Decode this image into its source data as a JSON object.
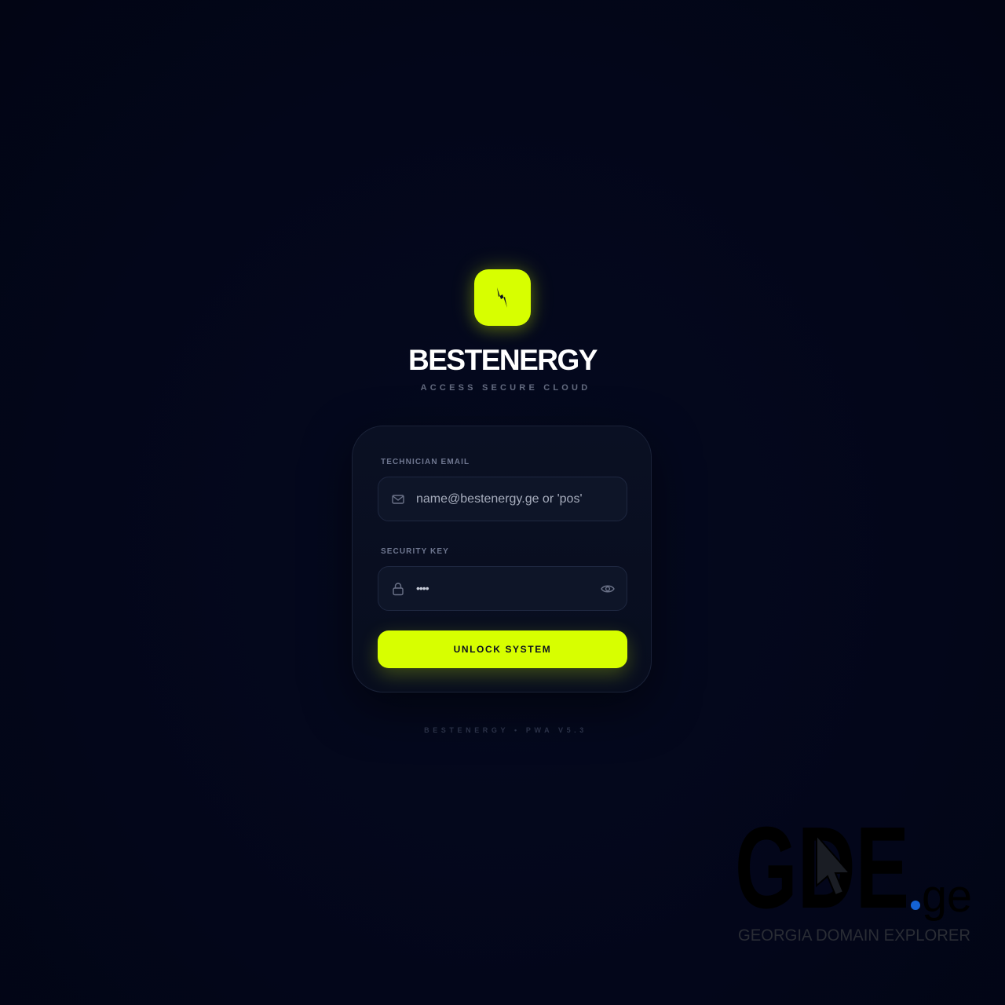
{
  "brand": {
    "title": "BESTENERGY",
    "subtitle": "ACCESS SECURE CLOUD",
    "logo_icon": "lightning-bolt-icon",
    "accent_color": "#d7ff00"
  },
  "login_form": {
    "email": {
      "label": "TECHNICIAN EMAIL",
      "placeholder": "name@bestenergy.ge or 'pos'",
      "icon": "mail-icon"
    },
    "security_key": {
      "label": "SECURITY KEY",
      "value_masked": "••••",
      "icon": "lock-icon",
      "toggle_icon": "eye-icon"
    },
    "submit_label": "UNLOCK SYSTEM"
  },
  "footer": {
    "version_text": "BESTENERGY • PWA V5.3"
  },
  "watermark": {
    "logo_text": "GDE",
    "logo_suffix": ".ge",
    "tagline": "GEORGIA DOMAIN EXPLORER"
  }
}
